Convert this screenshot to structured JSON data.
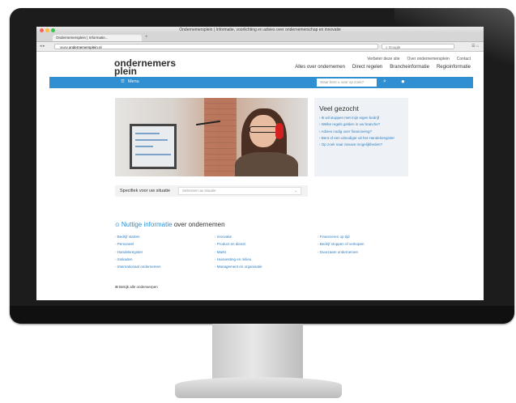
{
  "browser": {
    "window_title": "Ondernemersplein | Informatie, voorlichting en advies over ondernemerschap en innovatie",
    "tab_title": "Ondernemersplein | Informatie...",
    "url_prefix": "www.",
    "url_domain": "ondernemersplein.nl",
    "search_placeholder": "Google",
    "traffic_colors": [
      "#fc605c",
      "#fdbc40",
      "#34c84a"
    ]
  },
  "site": {
    "logo_line1": "ondernemers",
    "logo_line2": "plein",
    "top_links": [
      "Verbeter deze site",
      "Over ondernemersplein",
      "Contact"
    ],
    "main_nav": [
      "Alles over ondernemen",
      "Direct regelen",
      "Brancheinformatie",
      "Regioinformatie"
    ],
    "menu_label": "Menu",
    "search_placeholder": "Waar bent u naar op zoek?",
    "accent_color": "#2f8fd1"
  },
  "veel_gezocht": {
    "title": "Veel gezocht",
    "items": [
      "Ik wil stoppen met mijn eigen bedrijf",
      "Welke regels gelden in uw branche?",
      "Advies nodig over financiering?",
      "Bent of een uitnodiger uit het Handelsregister",
      "Op zoek naar nieuwe mogelijkheden?"
    ]
  },
  "specifiek": {
    "label": "Specifiek voor uw situatie",
    "select_value": "Selecteer uw situatie"
  },
  "nuttige": {
    "title_highlight": "Nuttige informatie",
    "title_rest": "over ondernemen",
    "col1": [
      "Bedrijf starten",
      "Personeel",
      "Handelsregister",
      "Sinkaden",
      "Internationaal ondernemen"
    ],
    "col2": [
      "Innovatie",
      "Product en dienst",
      "Markt",
      "Huisvesting en milieu",
      "Management en organisatie"
    ],
    "col3": [
      "Financieren op tijd",
      "Bedrijf stoppen of verkopen",
      "Duurzaam ondernemen"
    ],
    "all_subjects": "Bekijk alle onderwerpen"
  }
}
